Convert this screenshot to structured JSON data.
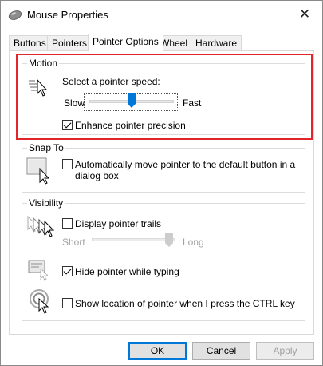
{
  "window": {
    "title": "Mouse Properties",
    "close_glyph": "✕"
  },
  "tabs": [
    {
      "label": "Buttons"
    },
    {
      "label": "Pointers"
    },
    {
      "label": "Pointer Options"
    },
    {
      "label": "Wheel"
    },
    {
      "label": "Hardware"
    }
  ],
  "motion": {
    "group_label": "Motion",
    "speed_label": "Select a pointer speed:",
    "slow_label": "Slow",
    "fast_label": "Fast",
    "speed_value_fraction": 0.5,
    "enhance_label": "Enhance pointer precision",
    "enhance_checked": true
  },
  "snap_to": {
    "group_label": "Snap To",
    "auto_move_label_line1": "Automatically move pointer to the default button in a",
    "auto_move_label_line2": "dialog box",
    "auto_move_checked": false
  },
  "visibility": {
    "group_label": "Visibility",
    "trails_label": "Display pointer trails",
    "trails_checked": false,
    "short_label": "Short",
    "long_label": "Long",
    "trails_length_fraction": 1.0,
    "hide_label": "Hide pointer while typing",
    "hide_checked": true,
    "show_location_label": "Show location of pointer when I press the CTRL key",
    "show_location_checked": false
  },
  "buttons": {
    "ok": "OK",
    "cancel": "Cancel",
    "apply": "Apply"
  },
  "colors": {
    "highlight": "#e0252b",
    "accent": "#0078d7"
  }
}
